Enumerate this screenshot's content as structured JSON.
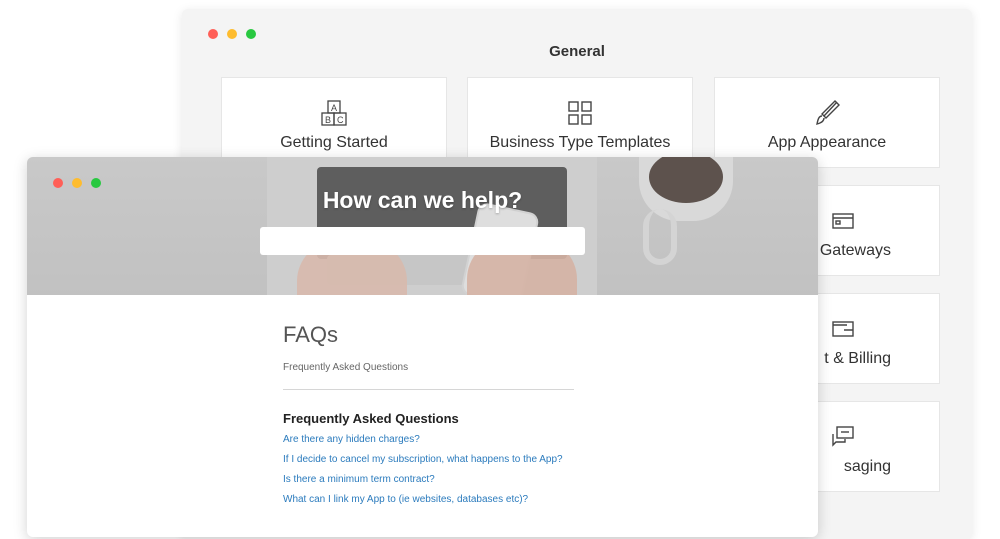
{
  "back_window": {
    "title": "General",
    "cards": [
      {
        "label": "Getting Started",
        "icon": "abc-blocks-icon"
      },
      {
        "label": "Business Type Templates",
        "icon": "grid-icon"
      },
      {
        "label": "App Appearance",
        "icon": "paintbrush-icon"
      },
      {
        "label": "t Gateways",
        "icon": "credit-card-icon"
      },
      {
        "label": "t & Billing",
        "icon": "wallet-icon"
      },
      {
        "label": "saging",
        "icon": "chat-icon"
      }
    ]
  },
  "front_window": {
    "hero_title": "How can we help?",
    "search_value": "",
    "faq_title": "FAQs",
    "faq_subtitle": "Frequently Asked Questions",
    "section_title": "Frequently Asked Questions",
    "questions": [
      "Are there any hidden charges?",
      "If I decide to cancel my subscription, what happens to the App?",
      "Is there a minimum term contract?",
      "What can I link my App to (ie websites, databases etc)?"
    ]
  }
}
